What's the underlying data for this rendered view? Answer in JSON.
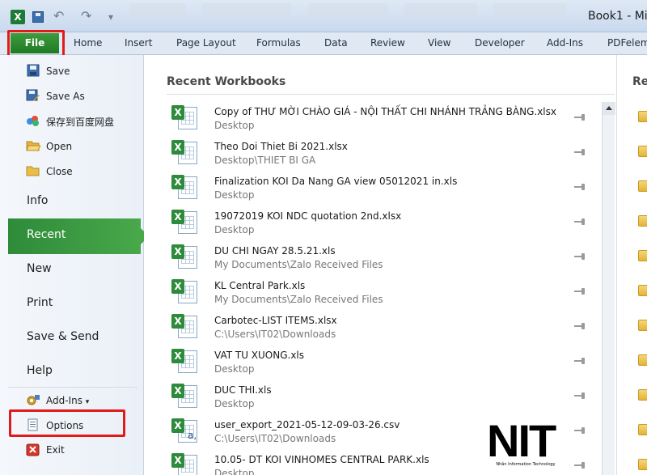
{
  "window": {
    "title": "Book1 - Mic"
  },
  "ribbon": {
    "file_label": "File",
    "tabs": [
      "Home",
      "Insert",
      "Page Layout",
      "Formulas",
      "Data",
      "Review",
      "View",
      "Developer",
      "Add-Ins",
      "PDFelem"
    ]
  },
  "nav": {
    "save": "Save",
    "save_as": "Save As",
    "baidu": "保存到百度网盘",
    "open": "Open",
    "close": "Close",
    "info": "Info",
    "recent": "Recent",
    "new": "New",
    "print": "Print",
    "save_send": "Save & Send",
    "help": "Help",
    "add_ins": "Add-Ins",
    "options": "Options",
    "exit": "Exit"
  },
  "recent_workbooks": {
    "heading": "Recent Workbooks",
    "items": [
      {
        "name": "Copy of THƯ MỜI CHÀO GIÁ - NỘI THẤT CHI NHÁNH TRẢNG BÀNG.xlsx",
        "path": "Desktop"
      },
      {
        "name": "Theo Doi Thiet Bi 2021.xlsx",
        "path": "Desktop\\THIET BI GA"
      },
      {
        "name": "Finalization KOI Da Nang GA view 05012021 in.xls",
        "path": "Desktop"
      },
      {
        "name": "19072019 KOI NDC quotation 2nd.xlsx",
        "path": "Desktop"
      },
      {
        "name": "DU CHI NGAY 28.5.21.xls",
        "path": "My Documents\\Zalo Received Files"
      },
      {
        "name": "KL Central Park.xls",
        "path": "My Documents\\Zalo Received Files"
      },
      {
        "name": "Carbotec-LIST ITEMS.xlsx",
        "path": "C:\\Users\\IT02\\Downloads"
      },
      {
        "name": "VAT TU XUONG.xls",
        "path": "Desktop"
      },
      {
        "name": "DUC THI.xls",
        "path": "Desktop"
      },
      {
        "name": "user_export_2021-05-12-09-03-26.csv",
        "path": "C:\\Users\\IT02\\Downloads"
      },
      {
        "name": "10.05- DT KOI VINHOMES CENTRAL PARK.xls",
        "path": "Desktop"
      }
    ]
  },
  "right_pane": {
    "heading": "Re"
  },
  "watermark": {
    "logo": "NIT",
    "subtitle": "Nhân Information Technology"
  }
}
